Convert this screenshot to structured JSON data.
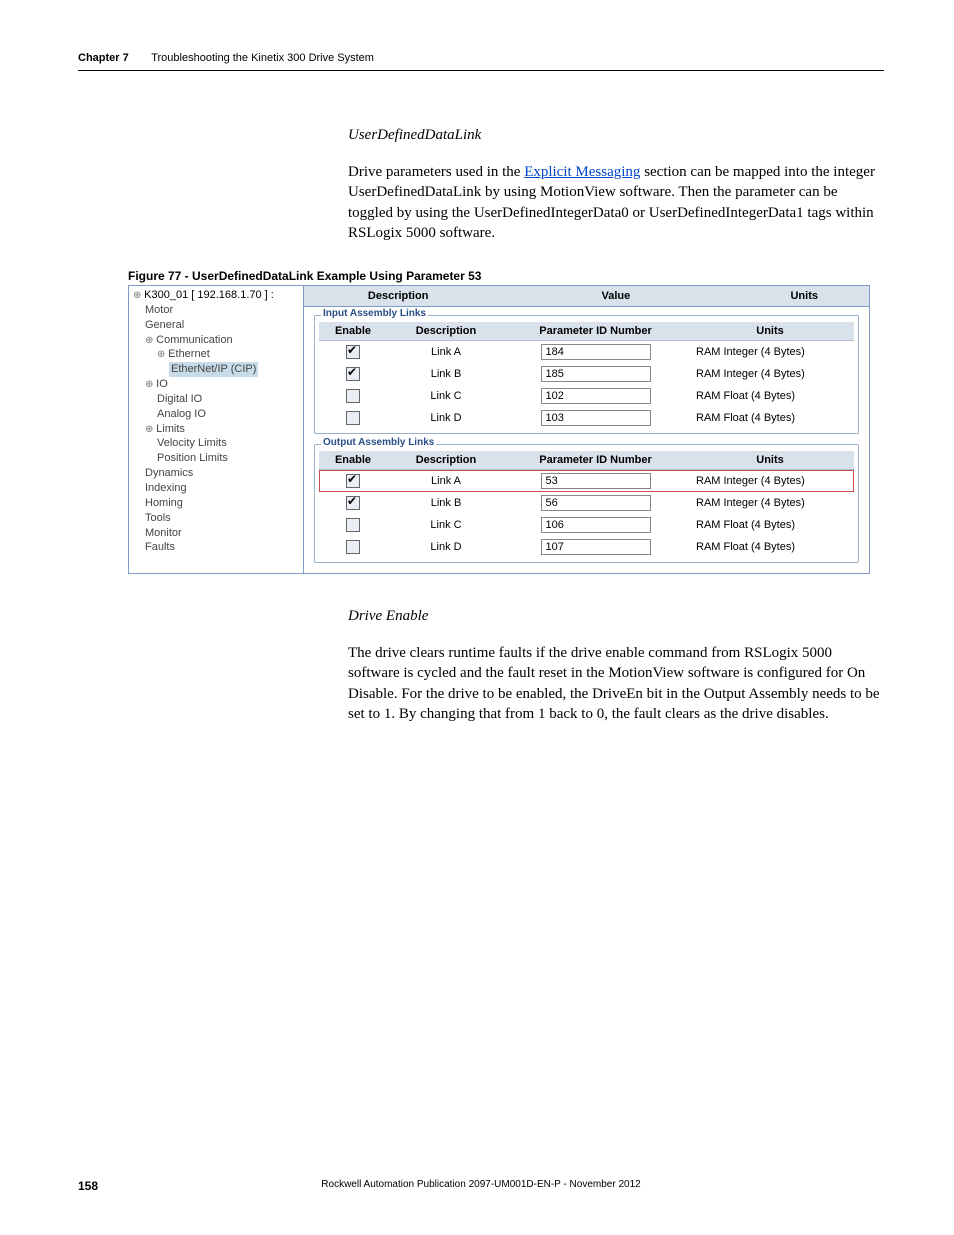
{
  "header": {
    "chapter": "Chapter 7",
    "title": "Troubleshooting the Kinetix 300 Drive System"
  },
  "section1": {
    "heading": "UserDefinedDataLink",
    "para_pre": "Drive parameters used in the ",
    "link_text": "Explicit Messaging",
    "para_post": " section can be mapped into the integer UserDefinedDataLink by using MotionView software. Then the parameter can be toggled by using the UserDefinedIntegerData0 or UserDefinedIntegerData1 tags within RSLogix 5000 software."
  },
  "figure": {
    "caption": "Figure 77 - UserDefinedDataLink Example Using Parameter 53",
    "tree_root": "K300_01 [ 192.168.1.70 ] :",
    "tree": {
      "motor": "Motor",
      "general": "General",
      "comm": "Communication",
      "eth": "Ethernet",
      "cip": "EtherNet/IP (CIP)",
      "io": "IO",
      "dio": "Digital IO",
      "aio": "Analog IO",
      "limits": "Limits",
      "vlim": "Velocity Limits",
      "plim": "Position Limits",
      "dyn": "Dynamics",
      "idx": "Indexing",
      "hom": "Homing",
      "tools": "Tools",
      "mon": "Monitor",
      "faults": "Faults"
    },
    "top": {
      "desc": "Description",
      "value": "Value",
      "units": "Units"
    },
    "grp_in": "Input Assembly Links",
    "grp_out": "Output Assembly Links",
    "cols": {
      "en": "Enable",
      "desc": "Description",
      "pid": "Parameter ID Number",
      "units": "Units"
    },
    "u_int": "RAM Integer (4 Bytes)",
    "u_flt": "RAM Float (4 Bytes)",
    "in_rows": [
      {
        "en": true,
        "desc": "Link A",
        "pid": "184",
        "units": "RAM Integer (4 Bytes)"
      },
      {
        "en": true,
        "desc": "Link B",
        "pid": "185",
        "units": "RAM Integer (4 Bytes)"
      },
      {
        "en": false,
        "desc": "Link C",
        "pid": "102",
        "units": "RAM Float (4 Bytes)"
      },
      {
        "en": false,
        "desc": "Link D",
        "pid": "103",
        "units": "RAM Float (4 Bytes)"
      }
    ],
    "out_rows": [
      {
        "en": true,
        "desc": "Link A",
        "pid": "53",
        "units": "RAM Integer (4 Bytes)",
        "hl": true
      },
      {
        "en": true,
        "desc": "Link B",
        "pid": "56",
        "units": "RAM Integer (4 Bytes)"
      },
      {
        "en": false,
        "desc": "Link C",
        "pid": "106",
        "units": "RAM Float (4 Bytes)"
      },
      {
        "en": false,
        "desc": "Link D",
        "pid": "107",
        "units": "RAM Float (4 Bytes)"
      }
    ]
  },
  "section2": {
    "heading": "Drive Enable",
    "para": "The drive clears runtime faults if the drive enable command from RSLogix 5000 software is cycled and the fault reset in the MotionView software is configured for On Disable. For the drive to be enabled, the DriveEn bit in the Output Assembly needs to be set to 1. By changing that from 1 back to 0, the fault clears as the drive disables."
  },
  "footer": {
    "page": "158",
    "pub": "Rockwell Automation Publication 2097-UM001D-EN-P - November 2012"
  }
}
